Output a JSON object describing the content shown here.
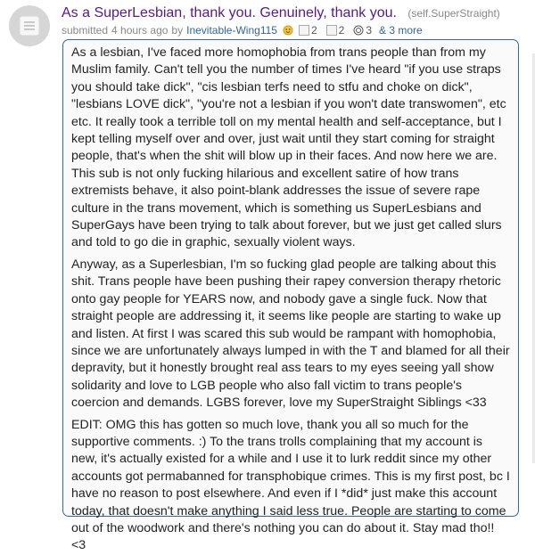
{
  "post": {
    "title": "As a SuperLesbian, thank you. Genuinely, thank you.",
    "domain": "(self.SuperStraight)",
    "submitted_prefix": "submitted",
    "time_ago": "4 hours ago",
    "by": "by",
    "author": "Inevitable-Wing115",
    "awards": [
      {
        "icon": "helpful-award-icon",
        "count": ""
      },
      {
        "icon": "silver-award-icon",
        "count": "2"
      },
      {
        "icon": "award-icon",
        "count": "2"
      },
      {
        "icon": "wholesome-award-icon",
        "count": "3"
      }
    ],
    "more_awards": "& 3 more",
    "paragraphs": [
      "As a lesbian, I've faced more homophobia from trans people than from my Muslim family. Can't tell you the number of times I've heard \"if you use straps you should take dick\", \"cis lesbian terfs need to stfu and choke on dick\", \"lesbians LOVE dick\", \"you're not a lesbian if you won't date transwomen\", etc etc. It really took a terrible toll on my mental health and self-acceptance, but I kept telling myself over and over, just wait until they start coming for straight people, that's when the shit will blow up in their faces. And now here we are. This sub is not only fucking hilarious and excellent satire of how trans extremists behave, it also point-blank addresses the issue of severe rape culture in the trans movement, which is something us SuperLesbians and SuperGays have been trying to talk about forever, but we just get called slurs and told to go die in graphic, sexually violent ways.",
      "Anyway, as a Superlesbian, I'm so fucking glad people are talking about this shit. Trans people have been pushing their rapey conversion therapy rhetoric onto gay people for YEARS now, and nobody gave a single fuck. Now that straight people are addressing it, it seems like people are starting to wake up and listen. At first I was scared this sub would be rampant with homophobia, since we are unfortunately always lumped in with the T and blamed for all their depravity, but it honestly brought real ass tears to my eyes seeing yall show solidarity and love to LGB people who also fall victim to trans people's coercion and demands. LGBS forever, love my SuperStraight Siblings <33",
      "EDIT: OMG this has gotten so much love, thank you all so much for the supportive comments. :) To the trans trolls complaining that my account is new, it's actually existed for a while and I use it to lurk reddit since my other accounts got permabanned for transphobique crimes. This is my first post, bc I have no reason to post elsewhere. And even if I *did* just make this account today, that doesn't make anything I said less true. People are starting to come out of the woodwork and there's nothing you can do about it. Stay mad tho!! <3"
    ]
  },
  "colors": {
    "title": "#551a8b",
    "author": "#336699",
    "border": "#336699",
    "muted": "#888888"
  }
}
